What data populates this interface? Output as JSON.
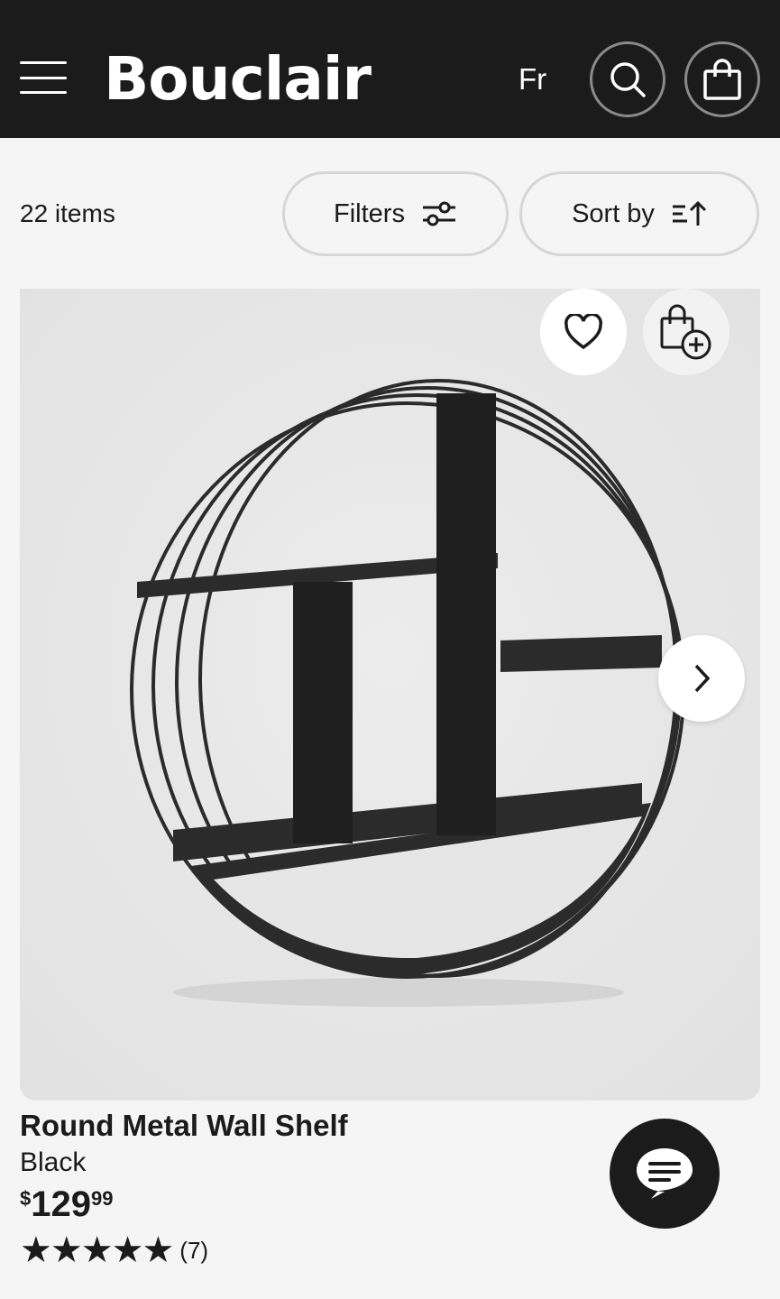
{
  "header": {
    "brand": "Bouclair",
    "language": "Fr",
    "icons": {
      "menu": "hamburger-menu-icon",
      "search": "search-icon",
      "cart": "shopping-bag-icon"
    }
  },
  "toolbar": {
    "item_count": "22 items",
    "filters_label": "Filters",
    "sort_label": "Sort by"
  },
  "product": {
    "name": "Round Metal Wall Shelf",
    "color": "Black",
    "price": {
      "currency": "$",
      "dollars": "129",
      "cents": "99"
    },
    "rating_stars": "★★★★★",
    "rating_value": 5,
    "review_count": "(7)"
  },
  "colors": {
    "header_bg": "#1b1b1b",
    "page_bg": "#f5f5f5",
    "image_bg": "#e6e6e6",
    "shelf": "#2b2b2b"
  }
}
